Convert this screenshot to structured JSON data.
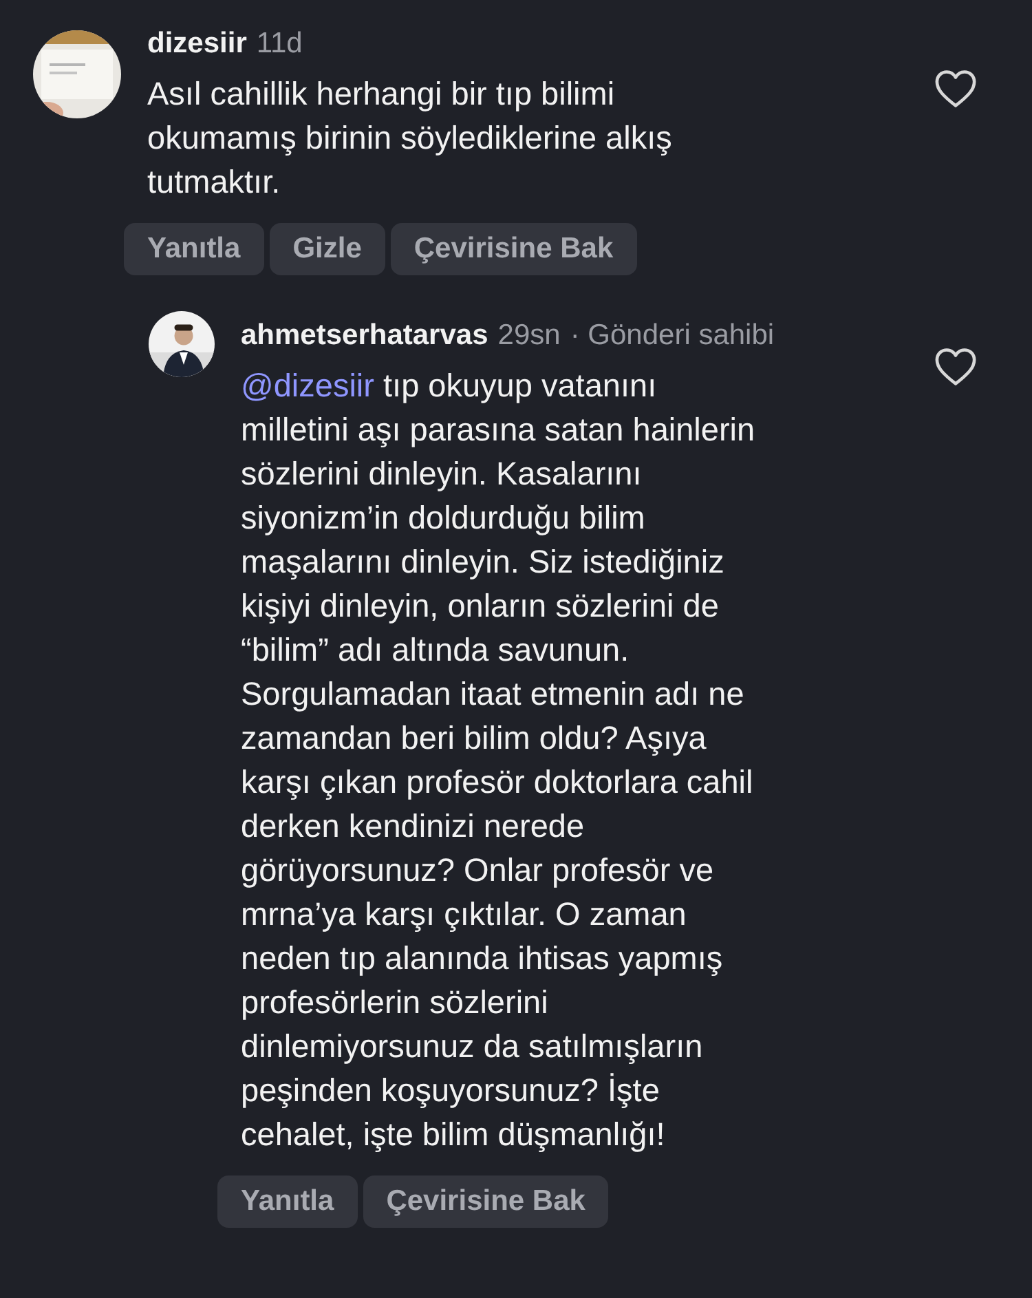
{
  "comments": [
    {
      "username": "dizesiir",
      "time": "11d",
      "text": "Asıl cahillik herhangi bir tıp bilimi\nokumamış birinin söylediklerine alkış\ntutmaktır.",
      "actions": [
        "Yanıtla",
        "Gizle",
        "Çevirisine Bak"
      ],
      "reply": false,
      "avatar": {
        "kind": "picture"
      }
    },
    {
      "username": "ahmetserhatarvas",
      "time": "29sn",
      "owner_label": "· Gönderi sahibi",
      "mention": "@dizesiir",
      "text": " tıp okuyup vatanını\nmilletini aşı parasına satan hainlerin\nsözlerini dinleyin. Kasalarını\nsiyonizm’in doldurduğu bilim\nmaşalarını dinleyin. Siz istediğiniz\nkişiyi dinleyin, onların sözlerini de\n“bilim” adı altında savunun.\nSorgulamadan itaat etmenin adı ne\nzamandan beri bilim oldu? Aşıya\nkarşı çıkan profesör doktorlara cahil\nderken kendinizi nerede\ngörüyorsunuz? Onlar profesör ve\nmrna’ya karşı çıktılar. O zaman\nneden tıp alanında ihtisas yapmış\nprofesörlerin sözlerini\ndinlemiyorsunuz da satılmışların\npeşinden koşuyorsunuz? İşte\ncehalet, işte bilim düşmanlığı!",
      "actions": [
        "Yanıtla",
        "Çevirisine Bak"
      ],
      "reply": true,
      "avatar": {
        "kind": "picture"
      }
    }
  ]
}
